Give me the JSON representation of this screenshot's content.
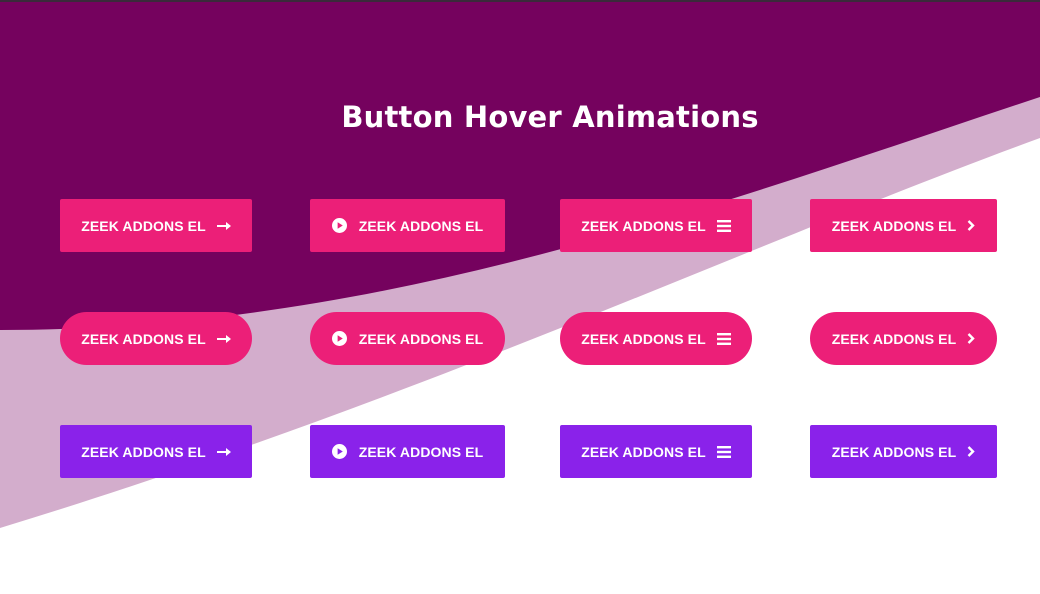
{
  "page": {
    "title": "Button Hover Animations"
  },
  "colors": {
    "dark_purple": "#75025e",
    "light_lavender": "#d3adcc",
    "pink": "#ec1f78",
    "purple": "#8a22ea",
    "white": "#ffffff"
  },
  "buttons": {
    "row1": [
      {
        "label": "ZEEK ADDONS EL",
        "icon": "arrow-right-icon"
      },
      {
        "label": "ZEEK ADDONS EL",
        "icon": "play-circle-icon"
      },
      {
        "label": "ZEEK ADDONS EL",
        "icon": "menu-bars-icon"
      },
      {
        "label": "ZEEK ADDONS EL",
        "icon": "chevron-right-icon"
      }
    ],
    "row2": [
      {
        "label": "ZEEK ADDONS EL",
        "icon": "arrow-right-icon"
      },
      {
        "label": "ZEEK ADDONS EL",
        "icon": "play-circle-icon"
      },
      {
        "label": "ZEEK ADDONS EL",
        "icon": "menu-bars-icon"
      },
      {
        "label": "ZEEK ADDONS EL",
        "icon": "chevron-right-icon"
      }
    ],
    "row3": [
      {
        "label": "ZEEK ADDONS EL",
        "icon": "arrow-right-icon"
      },
      {
        "label": "ZEEK ADDONS EL",
        "icon": "play-circle-icon"
      },
      {
        "label": "ZEEK ADDONS EL",
        "icon": "menu-bars-icon"
      },
      {
        "label": "ZEEK ADDONS EL",
        "icon": "chevron-right-icon"
      }
    ]
  }
}
